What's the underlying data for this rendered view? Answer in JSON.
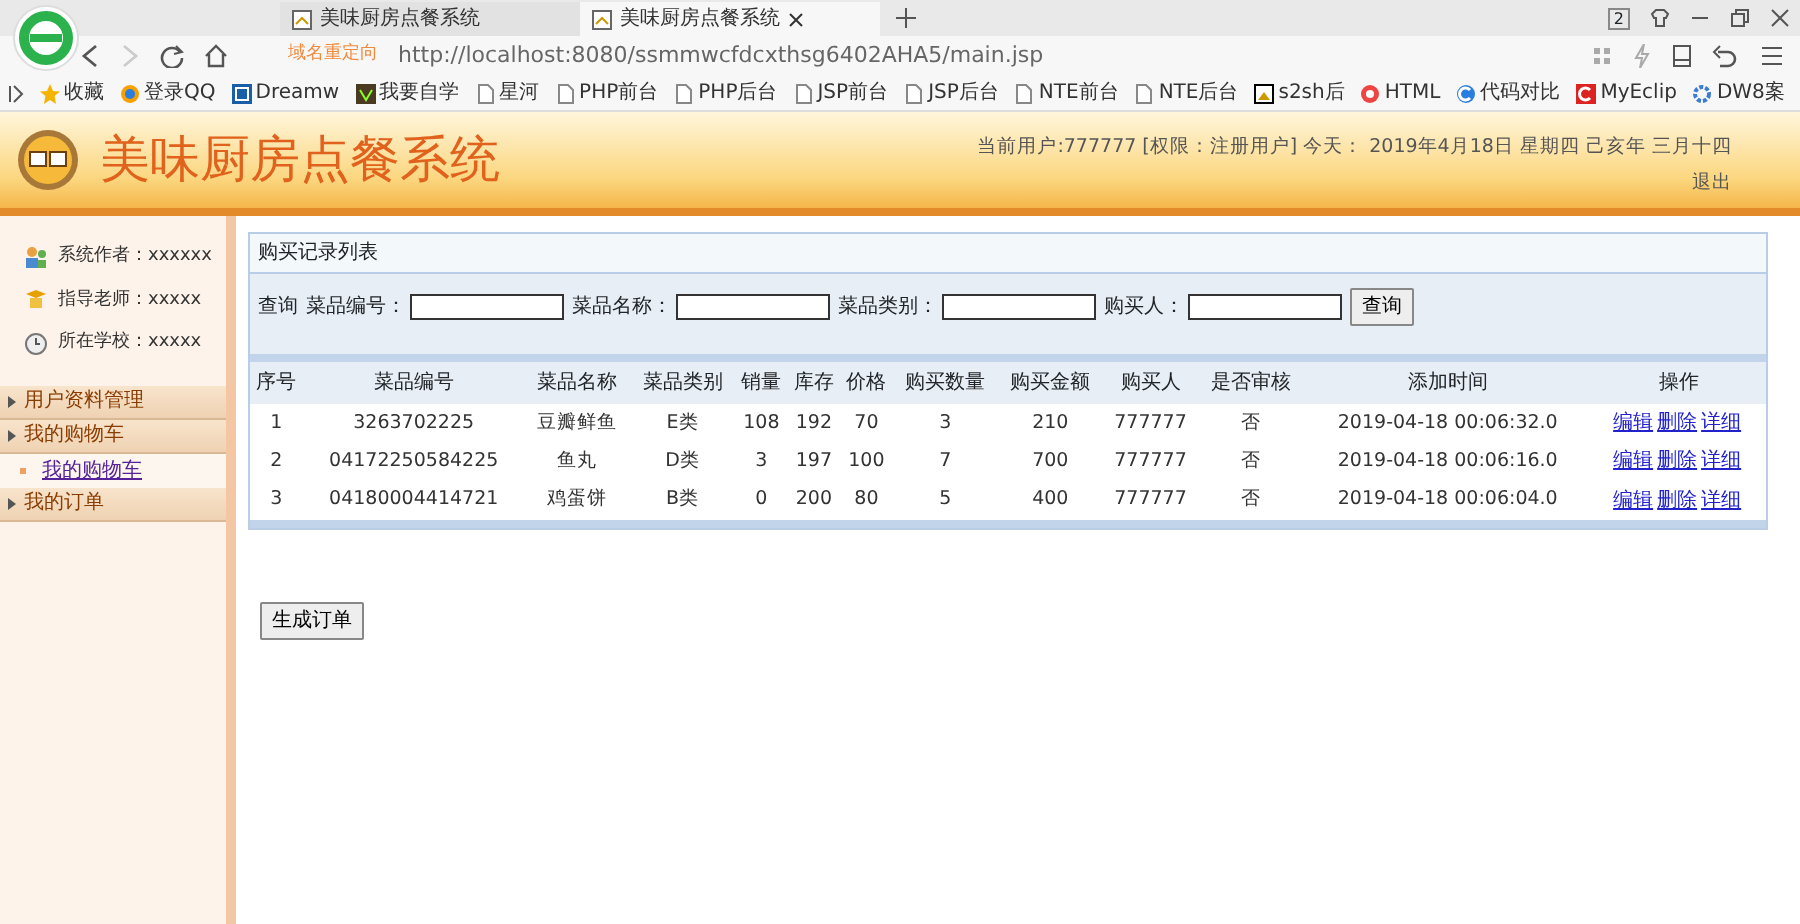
{
  "browser": {
    "tabs": [
      {
        "title": "美味厨房点餐系统",
        "selected": false
      },
      {
        "title": "美味厨房点餐系统",
        "selected": true
      }
    ],
    "tab_count": "2",
    "redirect_label": "域名重定向",
    "url": "http://localhost:8080/ssmmwcfdcxthsg6402AHA5/main.jsp",
    "bookmarks": [
      {
        "label": "收藏",
        "kind": "star"
      },
      {
        "label": "登录QQ",
        "kind": "qq"
      },
      {
        "label": "Dreamw",
        "kind": "dw"
      },
      {
        "label": "我要自学",
        "kind": "learn"
      },
      {
        "label": "星河",
        "kind": "page"
      },
      {
        "label": "PHP前台",
        "kind": "page"
      },
      {
        "label": "PHP后台",
        "kind": "page"
      },
      {
        "label": "JSP前台",
        "kind": "page"
      },
      {
        "label": "JSP后台",
        "kind": "page"
      },
      {
        "label": "NTE前台",
        "kind": "page"
      },
      {
        "label": "NTE后台",
        "kind": "page"
      },
      {
        "label": "s2sh后",
        "kind": "img"
      },
      {
        "label": "HTML",
        "kind": "html"
      },
      {
        "label": "代码对比",
        "kind": "compare"
      },
      {
        "label": "MyEclip",
        "kind": "eclipse"
      },
      {
        "label": "DW8案",
        "kind": "gear"
      }
    ]
  },
  "header": {
    "title": "美味厨房点餐系统",
    "user_info": "当前用户:777777 [权限：注册用户] 今天： 2019年4月18日 星期四 己亥年 三月十四",
    "logout": "退出"
  },
  "sidebar": {
    "info": [
      {
        "text": "系统作者：xxxxxx",
        "kind": "people"
      },
      {
        "text": "指导老师：xxxxx",
        "kind": "teacher"
      },
      {
        "text": "所在学校：xxxxx",
        "kind": "clock"
      }
    ],
    "menu": [
      {
        "label": "用户资料管理"
      },
      {
        "label": "我的购物车",
        "children": [
          {
            "label": "我的购物车"
          }
        ]
      },
      {
        "label": "我的订单"
      }
    ]
  },
  "panel": {
    "title": "购买记录列表",
    "search": {
      "prefix": "查询",
      "fields": [
        {
          "label": "菜品编号："
        },
        {
          "label": "菜品名称："
        },
        {
          "label": "菜品类别："
        },
        {
          "label": "购买人："
        }
      ],
      "button": "查询"
    },
    "table": {
      "columns": [
        "序号",
        "菜品编号",
        "菜品名称",
        "菜品类别",
        "销量",
        "库存",
        "价格",
        "购买数量",
        "购买金额",
        "购买人",
        "是否审核",
        "添加时间",
        "操作"
      ],
      "rows": [
        {
          "cells": [
            "1",
            "3263702225",
            "豆瓣鲜鱼",
            "E类",
            "108",
            "192",
            "70",
            "3",
            "210",
            "777777",
            "否",
            "2019-04-18 00:06:32.0"
          ],
          "actions": [
            "编辑",
            "删除",
            "详细"
          ]
        },
        {
          "cells": [
            "2",
            "04172250584225",
            "鱼丸",
            "D类",
            "3",
            "197",
            "100",
            "7",
            "700",
            "777777",
            "否",
            "2019-04-18 00:06:16.0"
          ],
          "actions": [
            "编辑",
            "删除",
            "详细"
          ]
        },
        {
          "cells": [
            "3",
            "04180004414721",
            "鸡蛋饼",
            "B类",
            "0",
            "200",
            "80",
            "5",
            "400",
            "777777",
            "否",
            "2019-04-18 00:06:04.0"
          ],
          "actions": [
            "编辑",
            "删除",
            "详细"
          ]
        }
      ]
    }
  },
  "generate_button": "生成订单"
}
